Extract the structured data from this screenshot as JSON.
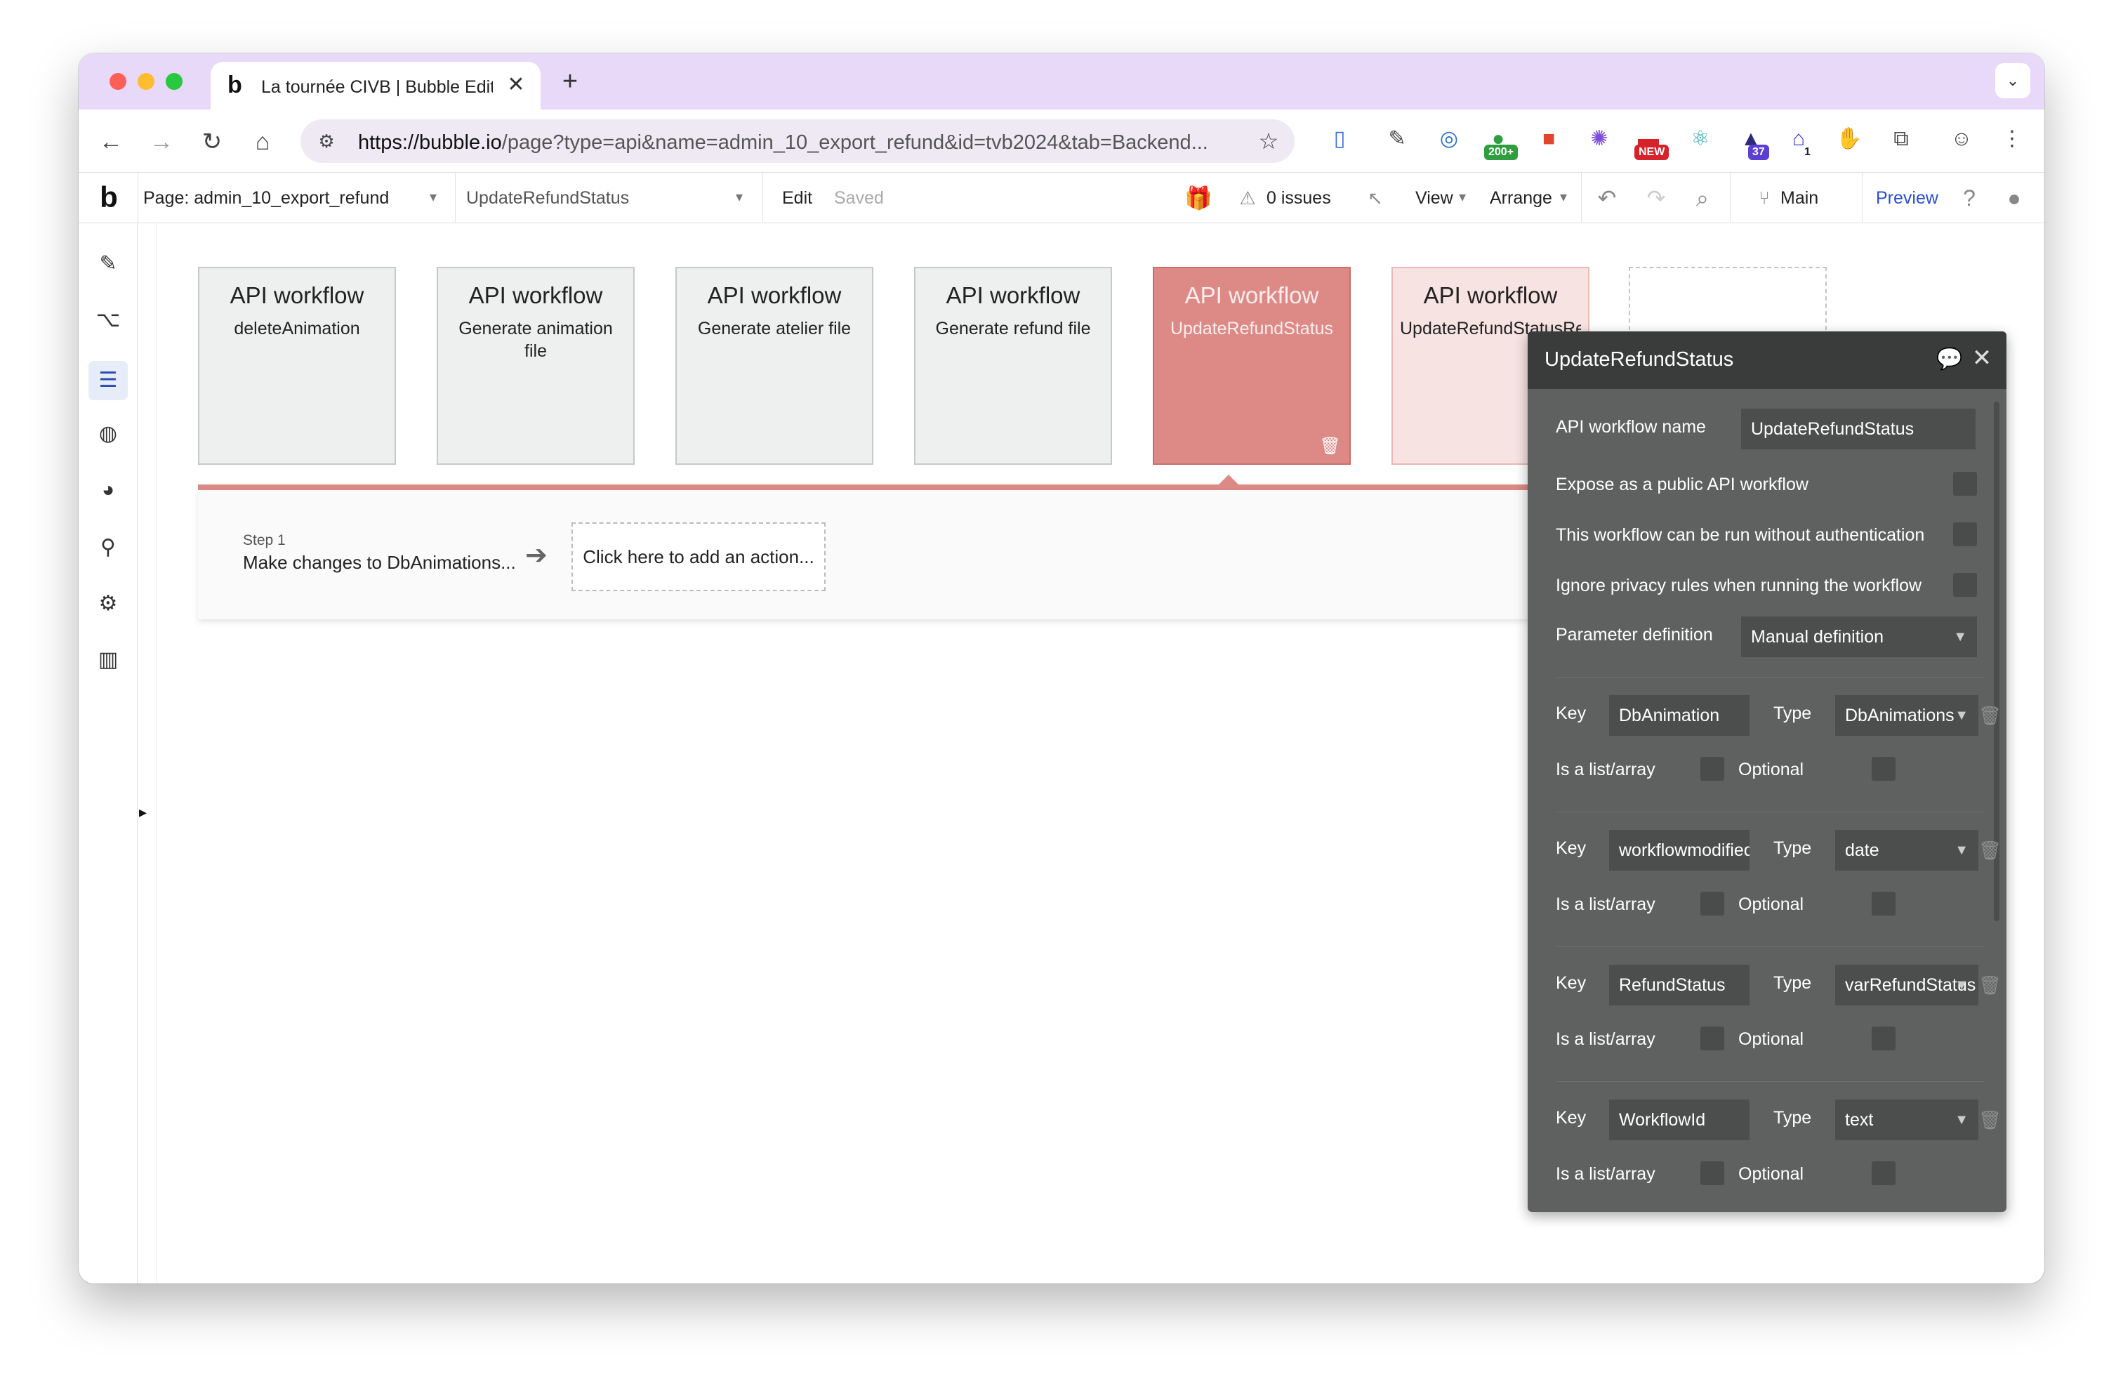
{
  "browser": {
    "tab_title": "La tournée CIVB | Bubble Editor",
    "tab_favicon": "b",
    "tab_close": "✕",
    "new_tab": "+",
    "url_host": "https://bubble.io",
    "url_path": "/page?type=api&name=admin_10_export_refund&id=tvb2024&tab=Backend...",
    "ext_badge_1": "200+",
    "ext_badge_2": "NEW",
    "ext_badge_3": "37",
    "ext_badge_4": "1",
    "colors": {
      "tabbar": "#e7d9f7",
      "omnibox": "#efe9f4"
    }
  },
  "editor": {
    "logo": "b",
    "page_label": "Page: admin_10_export_refund",
    "workflow_select": "UpdateRefundStatus",
    "edit": "Edit",
    "saved": "Saved",
    "issues": "0 issues",
    "view": "View",
    "arrange": "Arrange",
    "branch": "Main",
    "preview": "Preview",
    "colors": {
      "preview_link": "#2a4fd6",
      "selected_card": "#dd8a86"
    }
  },
  "rail": {
    "items": [
      "design-pencil-icon",
      "workflow-icon",
      "backend-workflows-icon",
      "data-icon",
      "styles-icon",
      "plugins-icon",
      "settings-icon",
      "logs-icon"
    ]
  },
  "workflows": [
    {
      "title": "API workflow",
      "name": "deleteAnimation"
    },
    {
      "title": "API workflow",
      "name": "Generate animation file"
    },
    {
      "title": "API workflow",
      "name": "Generate atelier file"
    },
    {
      "title": "API workflow",
      "name": "Generate refund file"
    },
    {
      "title": "API workflow",
      "name": "UpdateRefundStatus"
    },
    {
      "title": "API workflow",
      "name": "UpdateRefundStatusRe"
    }
  ],
  "step": {
    "number": "Step 1",
    "name": "Make changes to DbAnimations...",
    "add_action": "Click here to add an action..."
  },
  "panel": {
    "title": "UpdateRefundStatus",
    "name_label": "API workflow name",
    "name_value": "UpdateRefundStatus",
    "expose_label": "Expose as a public API workflow",
    "no_auth_label": "This workflow can be run without authentication",
    "privacy_label": "Ignore privacy rules when running the workflow",
    "param_def_label": "Parameter definition",
    "param_def_value": "Manual definition",
    "key_label": "Key",
    "type_label": "Type",
    "list_label": "Is a list/array",
    "optional_label": "Optional",
    "params": [
      {
        "key": "DbAnimation",
        "type": "DbAnimations"
      },
      {
        "key": "workflowmodified",
        "type": "date"
      },
      {
        "key": "RefundStatus",
        "type": "varRefundStatus"
      },
      {
        "key": "WorkflowId",
        "type": "text"
      }
    ]
  }
}
